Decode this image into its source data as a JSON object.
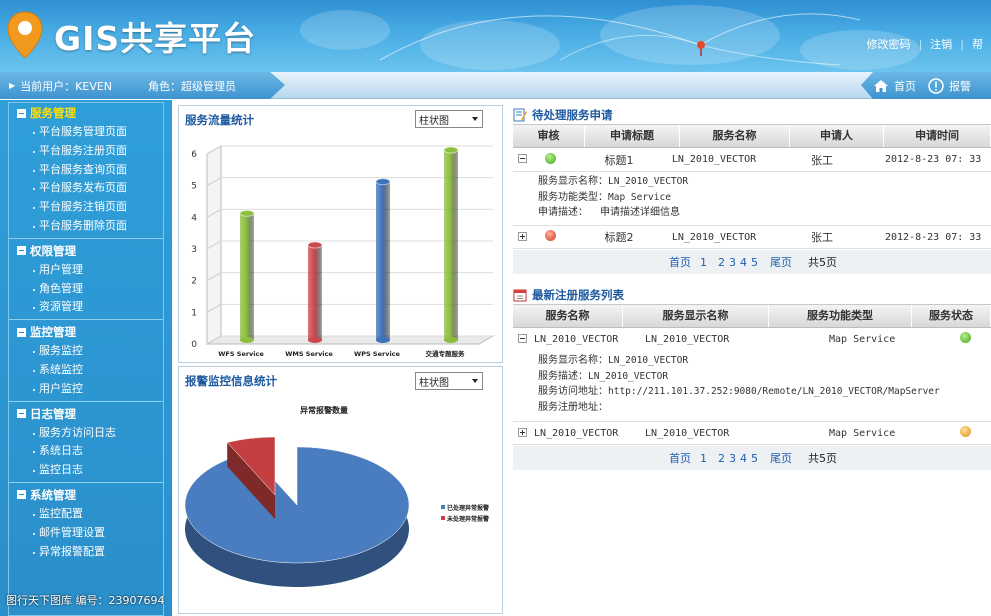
{
  "header": {
    "logo_text": "GIS共享平台",
    "links": [
      "修改密码",
      "注销",
      "帮"
    ]
  },
  "infobar": {
    "user_label": "当前用户：KEVEN",
    "role_label": "角色：超级管理员",
    "nav": [
      {
        "icon": "home-icon",
        "label": "首页"
      },
      {
        "icon": "alert-icon",
        "label": "报警"
      }
    ]
  },
  "sidebar": {
    "groups": [
      {
        "title": "服务管理",
        "active": true,
        "items": [
          "平台服务管理页面",
          "平台服务注册页面",
          "平台服务查询页面",
          "平台服务发布页面",
          "平台服务注销页面",
          "平台服务删除页面"
        ]
      },
      {
        "title": "权限管理",
        "active": false,
        "items": [
          "用户管理",
          "角色管理",
          "资源管理"
        ]
      },
      {
        "title": "监控管理",
        "active": false,
        "items": [
          "服务监控",
          "系统监控",
          "用户监控"
        ]
      },
      {
        "title": "日志管理",
        "active": false,
        "items": [
          "服务方访问日志",
          "系统日志",
          "监控日志"
        ]
      },
      {
        "title": "系统管理",
        "active": false,
        "items": [
          "监控配置",
          "邮件管理设置",
          "异常报警配置"
        ]
      }
    ]
  },
  "traffic_panel": {
    "title": "服务流量统计",
    "select_value": "柱状图"
  },
  "alarm_panel": {
    "title": "报警监控信息统计",
    "select_value": "柱状图"
  },
  "chart_data": [
    {
      "type": "bar",
      "categories": [
        "WFS Service",
        "WMS Service",
        "WPS Service",
        "交通专题服务"
      ],
      "values": [
        4,
        3,
        5,
        6
      ],
      "colors": [
        "#8cbf3f",
        "#c9484b",
        "#3f73b8",
        "#8cbf3f"
      ],
      "ylim": [
        0,
        6
      ],
      "yticks": [
        "0",
        "1",
        "2",
        "3",
        "4",
        "5",
        "6"
      ],
      "grid": true
    },
    {
      "type": "pie",
      "title": "异常报警数量",
      "slices": [
        {
          "label": "已处理异常报警",
          "value": 93,
          "color": "#4a7cc0"
        },
        {
          "label": "未处理异常报警",
          "value": 7,
          "color": "#c44040"
        }
      ],
      "legend": "right"
    }
  ],
  "pending": {
    "title": "待处理服务申请",
    "columns": [
      "审核",
      "申请标题",
      "服务名称",
      "申请人",
      "申请时间"
    ],
    "rows": [
      {
        "status": "ok",
        "title": "标题1",
        "service": "LN_2010_VECTOR",
        "applicant": "张工",
        "time": "2012-8-23 07: 33",
        "expanded": true
      },
      {
        "status": "no",
        "title": "标题2",
        "service": "LN_2010_VECTOR",
        "applicant": "张工",
        "time": "2012-8-23 07: 33",
        "expanded": false
      }
    ],
    "detail": [
      {
        "key": "服务显示名称：",
        "value": "LN_2010_VECTOR"
      },
      {
        "key": "服务功能类型：",
        "value": "Map Service"
      },
      {
        "key": "申请描述：",
        "value": "申请描述详细信息"
      }
    ],
    "pager": {
      "first": "首页",
      "pages": [
        "1",
        "2",
        "3",
        "4",
        "5"
      ],
      "last": "尾页",
      "total": "共5页"
    }
  },
  "registered": {
    "title": "最新注册服务列表",
    "columns": [
      "服务名称",
      "服务显示名称",
      "服务功能类型",
      "服务状态"
    ],
    "rows": [
      {
        "name": "LN_2010_VECTOR",
        "display": "LN_2010_VECTOR",
        "type": "Map Service",
        "status": "ok",
        "expanded": true
      },
      {
        "name": "LN_2010_VECTOR",
        "display": "LN_2010_VECTOR",
        "type": "Map Service",
        "status": "warn",
        "expanded": false
      }
    ],
    "detail": [
      {
        "key": "服务显示名称：",
        "value": "LN_2010_VECTOR"
      },
      {
        "key": "服务描述：",
        "value": "LN_2010_VECTOR"
      },
      {
        "key": "服务访问地址：",
        "value": "http://211.101.37.252:9080/Remote/LN_2010_VECTOR/MapServer"
      },
      {
        "key": "服务注册地址：",
        "value": ""
      }
    ],
    "pager": {
      "first": "首页",
      "pages": [
        "1",
        "2",
        "3",
        "4",
        "5"
      ],
      "last": "尾页",
      "total": "共5页"
    }
  },
  "watermark": "图行天下图库   编号：23907694",
  "colors": {
    "header_top": "#2f8fd2",
    "sidebar_bg": "#2a8fcb",
    "active_group": "#ffe100",
    "title_blue": "#1d5aa0",
    "link_blue": "#1f5fae"
  }
}
